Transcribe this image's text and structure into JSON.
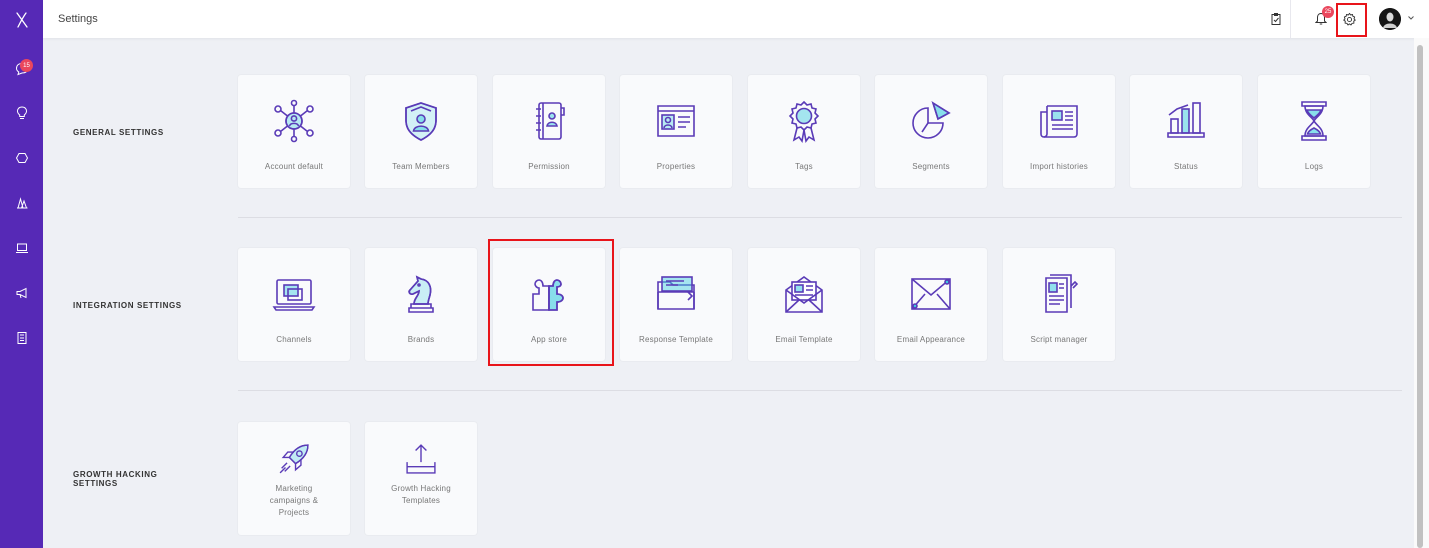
{
  "header": {
    "title": "Settings",
    "notification_count": "25"
  },
  "sidebar": {
    "items": [
      {
        "icon": "chat-icon",
        "badge": "15"
      },
      {
        "icon": "lightbulb-icon"
      },
      {
        "icon": "settings-cog-icon"
      },
      {
        "icon": "users-icon"
      },
      {
        "icon": "laptop-icon"
      },
      {
        "icon": "megaphone-icon"
      },
      {
        "icon": "calculator-icon"
      }
    ]
  },
  "sections": [
    {
      "title": "General Settings",
      "items": [
        {
          "label": "Account default",
          "icon": "account-network-icon"
        },
        {
          "label": "Team Members",
          "icon": "shield-user-icon"
        },
        {
          "label": "Permission",
          "icon": "contact-book-icon"
        },
        {
          "label": "Properties",
          "icon": "id-card-icon"
        },
        {
          "label": "Tags",
          "icon": "award-ribbon-icon"
        },
        {
          "label": "Segments",
          "icon": "pie-chart-icon"
        },
        {
          "label": "Import histories",
          "icon": "newspaper-icon"
        },
        {
          "label": "Status",
          "icon": "bar-stats-icon"
        },
        {
          "label": "Logs",
          "icon": "hourglass-icon"
        }
      ]
    },
    {
      "title": "Integration Settings",
      "items": [
        {
          "label": "Channels",
          "icon": "monitor-windows-icon"
        },
        {
          "label": "Brands",
          "icon": "chess-knight-icon"
        },
        {
          "label": "App store",
          "icon": "puzzle-icon"
        },
        {
          "label": "Response Template",
          "icon": "folder-files-icon"
        },
        {
          "label": "Email Template",
          "icon": "open-envelope-icon"
        },
        {
          "label": "Email Appearance",
          "icon": "envelope-icon"
        },
        {
          "label": "Script manager",
          "icon": "document-script-icon"
        }
      ]
    },
    {
      "title": "Growth Hacking Settings",
      "items": [
        {
          "label": "Marketing campaigns & Projects",
          "icon": "rocket-icon"
        },
        {
          "label": "Growth Hacking Templates",
          "icon": "upload-tray-icon"
        }
      ]
    }
  ],
  "colors": {
    "sidebar": "#5629b6",
    "icon_stroke": "#5a3bb7",
    "icon_accent": "#3ccbe0",
    "highlight": "#e8141a",
    "badge": "#ea475d"
  }
}
